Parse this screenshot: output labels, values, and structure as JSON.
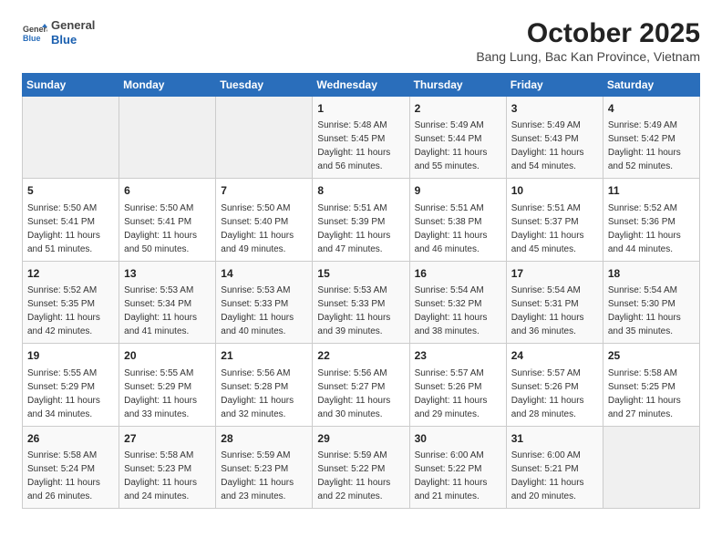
{
  "header": {
    "logo_line1": "General",
    "logo_line2": "Blue",
    "month_title": "October 2025",
    "location": "Bang Lung, Bac Kan Province, Vietnam"
  },
  "weekdays": [
    "Sunday",
    "Monday",
    "Tuesday",
    "Wednesday",
    "Thursday",
    "Friday",
    "Saturday"
  ],
  "weeks": [
    [
      {
        "day": "",
        "sunrise": "",
        "sunset": "",
        "daylight": "",
        "empty": true
      },
      {
        "day": "",
        "sunrise": "",
        "sunset": "",
        "daylight": "",
        "empty": true
      },
      {
        "day": "",
        "sunrise": "",
        "sunset": "",
        "daylight": "",
        "empty": true
      },
      {
        "day": "1",
        "sunrise": "Sunrise: 5:48 AM",
        "sunset": "Sunset: 5:45 PM",
        "daylight": "Daylight: 11 hours and 56 minutes."
      },
      {
        "day": "2",
        "sunrise": "Sunrise: 5:49 AM",
        "sunset": "Sunset: 5:44 PM",
        "daylight": "Daylight: 11 hours and 55 minutes."
      },
      {
        "day": "3",
        "sunrise": "Sunrise: 5:49 AM",
        "sunset": "Sunset: 5:43 PM",
        "daylight": "Daylight: 11 hours and 54 minutes."
      },
      {
        "day": "4",
        "sunrise": "Sunrise: 5:49 AM",
        "sunset": "Sunset: 5:42 PM",
        "daylight": "Daylight: 11 hours and 52 minutes."
      }
    ],
    [
      {
        "day": "5",
        "sunrise": "Sunrise: 5:50 AM",
        "sunset": "Sunset: 5:41 PM",
        "daylight": "Daylight: 11 hours and 51 minutes."
      },
      {
        "day": "6",
        "sunrise": "Sunrise: 5:50 AM",
        "sunset": "Sunset: 5:41 PM",
        "daylight": "Daylight: 11 hours and 50 minutes."
      },
      {
        "day": "7",
        "sunrise": "Sunrise: 5:50 AM",
        "sunset": "Sunset: 5:40 PM",
        "daylight": "Daylight: 11 hours and 49 minutes."
      },
      {
        "day": "8",
        "sunrise": "Sunrise: 5:51 AM",
        "sunset": "Sunset: 5:39 PM",
        "daylight": "Daylight: 11 hours and 47 minutes."
      },
      {
        "day": "9",
        "sunrise": "Sunrise: 5:51 AM",
        "sunset": "Sunset: 5:38 PM",
        "daylight": "Daylight: 11 hours and 46 minutes."
      },
      {
        "day": "10",
        "sunrise": "Sunrise: 5:51 AM",
        "sunset": "Sunset: 5:37 PM",
        "daylight": "Daylight: 11 hours and 45 minutes."
      },
      {
        "day": "11",
        "sunrise": "Sunrise: 5:52 AM",
        "sunset": "Sunset: 5:36 PM",
        "daylight": "Daylight: 11 hours and 44 minutes."
      }
    ],
    [
      {
        "day": "12",
        "sunrise": "Sunrise: 5:52 AM",
        "sunset": "Sunset: 5:35 PM",
        "daylight": "Daylight: 11 hours and 42 minutes."
      },
      {
        "day": "13",
        "sunrise": "Sunrise: 5:53 AM",
        "sunset": "Sunset: 5:34 PM",
        "daylight": "Daylight: 11 hours and 41 minutes."
      },
      {
        "day": "14",
        "sunrise": "Sunrise: 5:53 AM",
        "sunset": "Sunset: 5:33 PM",
        "daylight": "Daylight: 11 hours and 40 minutes."
      },
      {
        "day": "15",
        "sunrise": "Sunrise: 5:53 AM",
        "sunset": "Sunset: 5:33 PM",
        "daylight": "Daylight: 11 hours and 39 minutes."
      },
      {
        "day": "16",
        "sunrise": "Sunrise: 5:54 AM",
        "sunset": "Sunset: 5:32 PM",
        "daylight": "Daylight: 11 hours and 38 minutes."
      },
      {
        "day": "17",
        "sunrise": "Sunrise: 5:54 AM",
        "sunset": "Sunset: 5:31 PM",
        "daylight": "Daylight: 11 hours and 36 minutes."
      },
      {
        "day": "18",
        "sunrise": "Sunrise: 5:54 AM",
        "sunset": "Sunset: 5:30 PM",
        "daylight": "Daylight: 11 hours and 35 minutes."
      }
    ],
    [
      {
        "day": "19",
        "sunrise": "Sunrise: 5:55 AM",
        "sunset": "Sunset: 5:29 PM",
        "daylight": "Daylight: 11 hours and 34 minutes."
      },
      {
        "day": "20",
        "sunrise": "Sunrise: 5:55 AM",
        "sunset": "Sunset: 5:29 PM",
        "daylight": "Daylight: 11 hours and 33 minutes."
      },
      {
        "day": "21",
        "sunrise": "Sunrise: 5:56 AM",
        "sunset": "Sunset: 5:28 PM",
        "daylight": "Daylight: 11 hours and 32 minutes."
      },
      {
        "day": "22",
        "sunrise": "Sunrise: 5:56 AM",
        "sunset": "Sunset: 5:27 PM",
        "daylight": "Daylight: 11 hours and 30 minutes."
      },
      {
        "day": "23",
        "sunrise": "Sunrise: 5:57 AM",
        "sunset": "Sunset: 5:26 PM",
        "daylight": "Daylight: 11 hours and 29 minutes."
      },
      {
        "day": "24",
        "sunrise": "Sunrise: 5:57 AM",
        "sunset": "Sunset: 5:26 PM",
        "daylight": "Daylight: 11 hours and 28 minutes."
      },
      {
        "day": "25",
        "sunrise": "Sunrise: 5:58 AM",
        "sunset": "Sunset: 5:25 PM",
        "daylight": "Daylight: 11 hours and 27 minutes."
      }
    ],
    [
      {
        "day": "26",
        "sunrise": "Sunrise: 5:58 AM",
        "sunset": "Sunset: 5:24 PM",
        "daylight": "Daylight: 11 hours and 26 minutes."
      },
      {
        "day": "27",
        "sunrise": "Sunrise: 5:58 AM",
        "sunset": "Sunset: 5:23 PM",
        "daylight": "Daylight: 11 hours and 24 minutes."
      },
      {
        "day": "28",
        "sunrise": "Sunrise: 5:59 AM",
        "sunset": "Sunset: 5:23 PM",
        "daylight": "Daylight: 11 hours and 23 minutes."
      },
      {
        "day": "29",
        "sunrise": "Sunrise: 5:59 AM",
        "sunset": "Sunset: 5:22 PM",
        "daylight": "Daylight: 11 hours and 22 minutes."
      },
      {
        "day": "30",
        "sunrise": "Sunrise: 6:00 AM",
        "sunset": "Sunset: 5:22 PM",
        "daylight": "Daylight: 11 hours and 21 minutes."
      },
      {
        "day": "31",
        "sunrise": "Sunrise: 6:00 AM",
        "sunset": "Sunset: 5:21 PM",
        "daylight": "Daylight: 11 hours and 20 minutes."
      },
      {
        "day": "",
        "sunrise": "",
        "sunset": "",
        "daylight": "",
        "empty": true
      }
    ]
  ]
}
